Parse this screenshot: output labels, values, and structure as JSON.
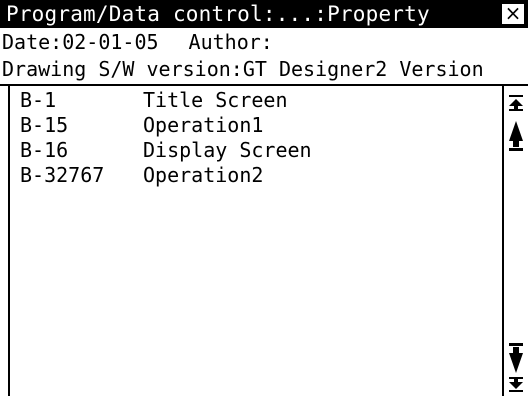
{
  "window": {
    "title": "Program/Data control:...:Property",
    "close_label": "×"
  },
  "info": {
    "date_label": "Date:02-01-05",
    "author_label": "Author:",
    "software_line": "Drawing S/W version:GT Designer2 Version"
  },
  "screens": [
    {
      "id": "B-1",
      "name": "Title Screen"
    },
    {
      "id": "B-15",
      "name": "Operation1"
    },
    {
      "id": "B-16",
      "name": "Display Screen"
    },
    {
      "id": "B-32767",
      "name": "Operation2"
    }
  ],
  "scrollbar": {
    "buttons": [
      "scroll-to-top",
      "scroll-up",
      "scroll-down",
      "scroll-to-bottom"
    ]
  }
}
